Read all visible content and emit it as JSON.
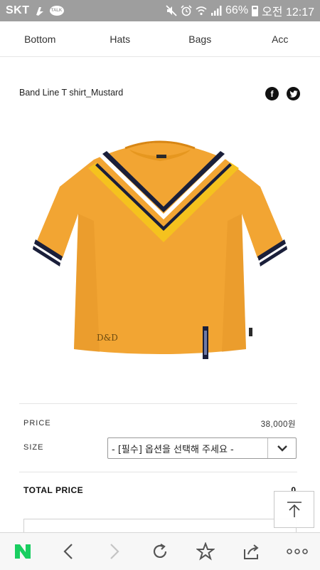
{
  "status_bar": {
    "carrier": "SKT",
    "talk_badge": "TALK",
    "battery": "66%",
    "clock": "오전 12:17",
    "icons": [
      "hand-bag-notification-icon",
      "talk-icon",
      "mute-icon",
      "alarm-icon",
      "wifi-icon",
      "signal-icon",
      "battery-icon"
    ]
  },
  "category_nav": {
    "items": [
      "Bottom",
      "Hats",
      "Bags",
      "Acc"
    ]
  },
  "product": {
    "title": "Band Line T shirt_Mustard",
    "share_icons": [
      "facebook-icon",
      "twitter-icon"
    ],
    "image_icon": "mustard-tshirt-image",
    "logo_text": "D&D"
  },
  "info": {
    "price_label": "PRICE",
    "price_value": "38,000원",
    "size_label": "SIZE",
    "size_select_value": "- [필수] 옵션을 선택해 주세요 -",
    "total_label": "TOTAL PRICE",
    "total_value": "0"
  },
  "toolbar": {
    "icons": [
      "naver-home-icon",
      "back-icon",
      "forward-icon",
      "reload-icon",
      "bookmark-star-icon",
      "share-icon",
      "more-icon"
    ],
    "naver_letter": "N"
  },
  "colors": {
    "status_bar": "#9e9e9e",
    "mustard": "#f2a533",
    "naver_green": "#19ce60",
    "stripe_navy": "#1a1f3a",
    "stripe_yellow": "#f5c21e"
  }
}
